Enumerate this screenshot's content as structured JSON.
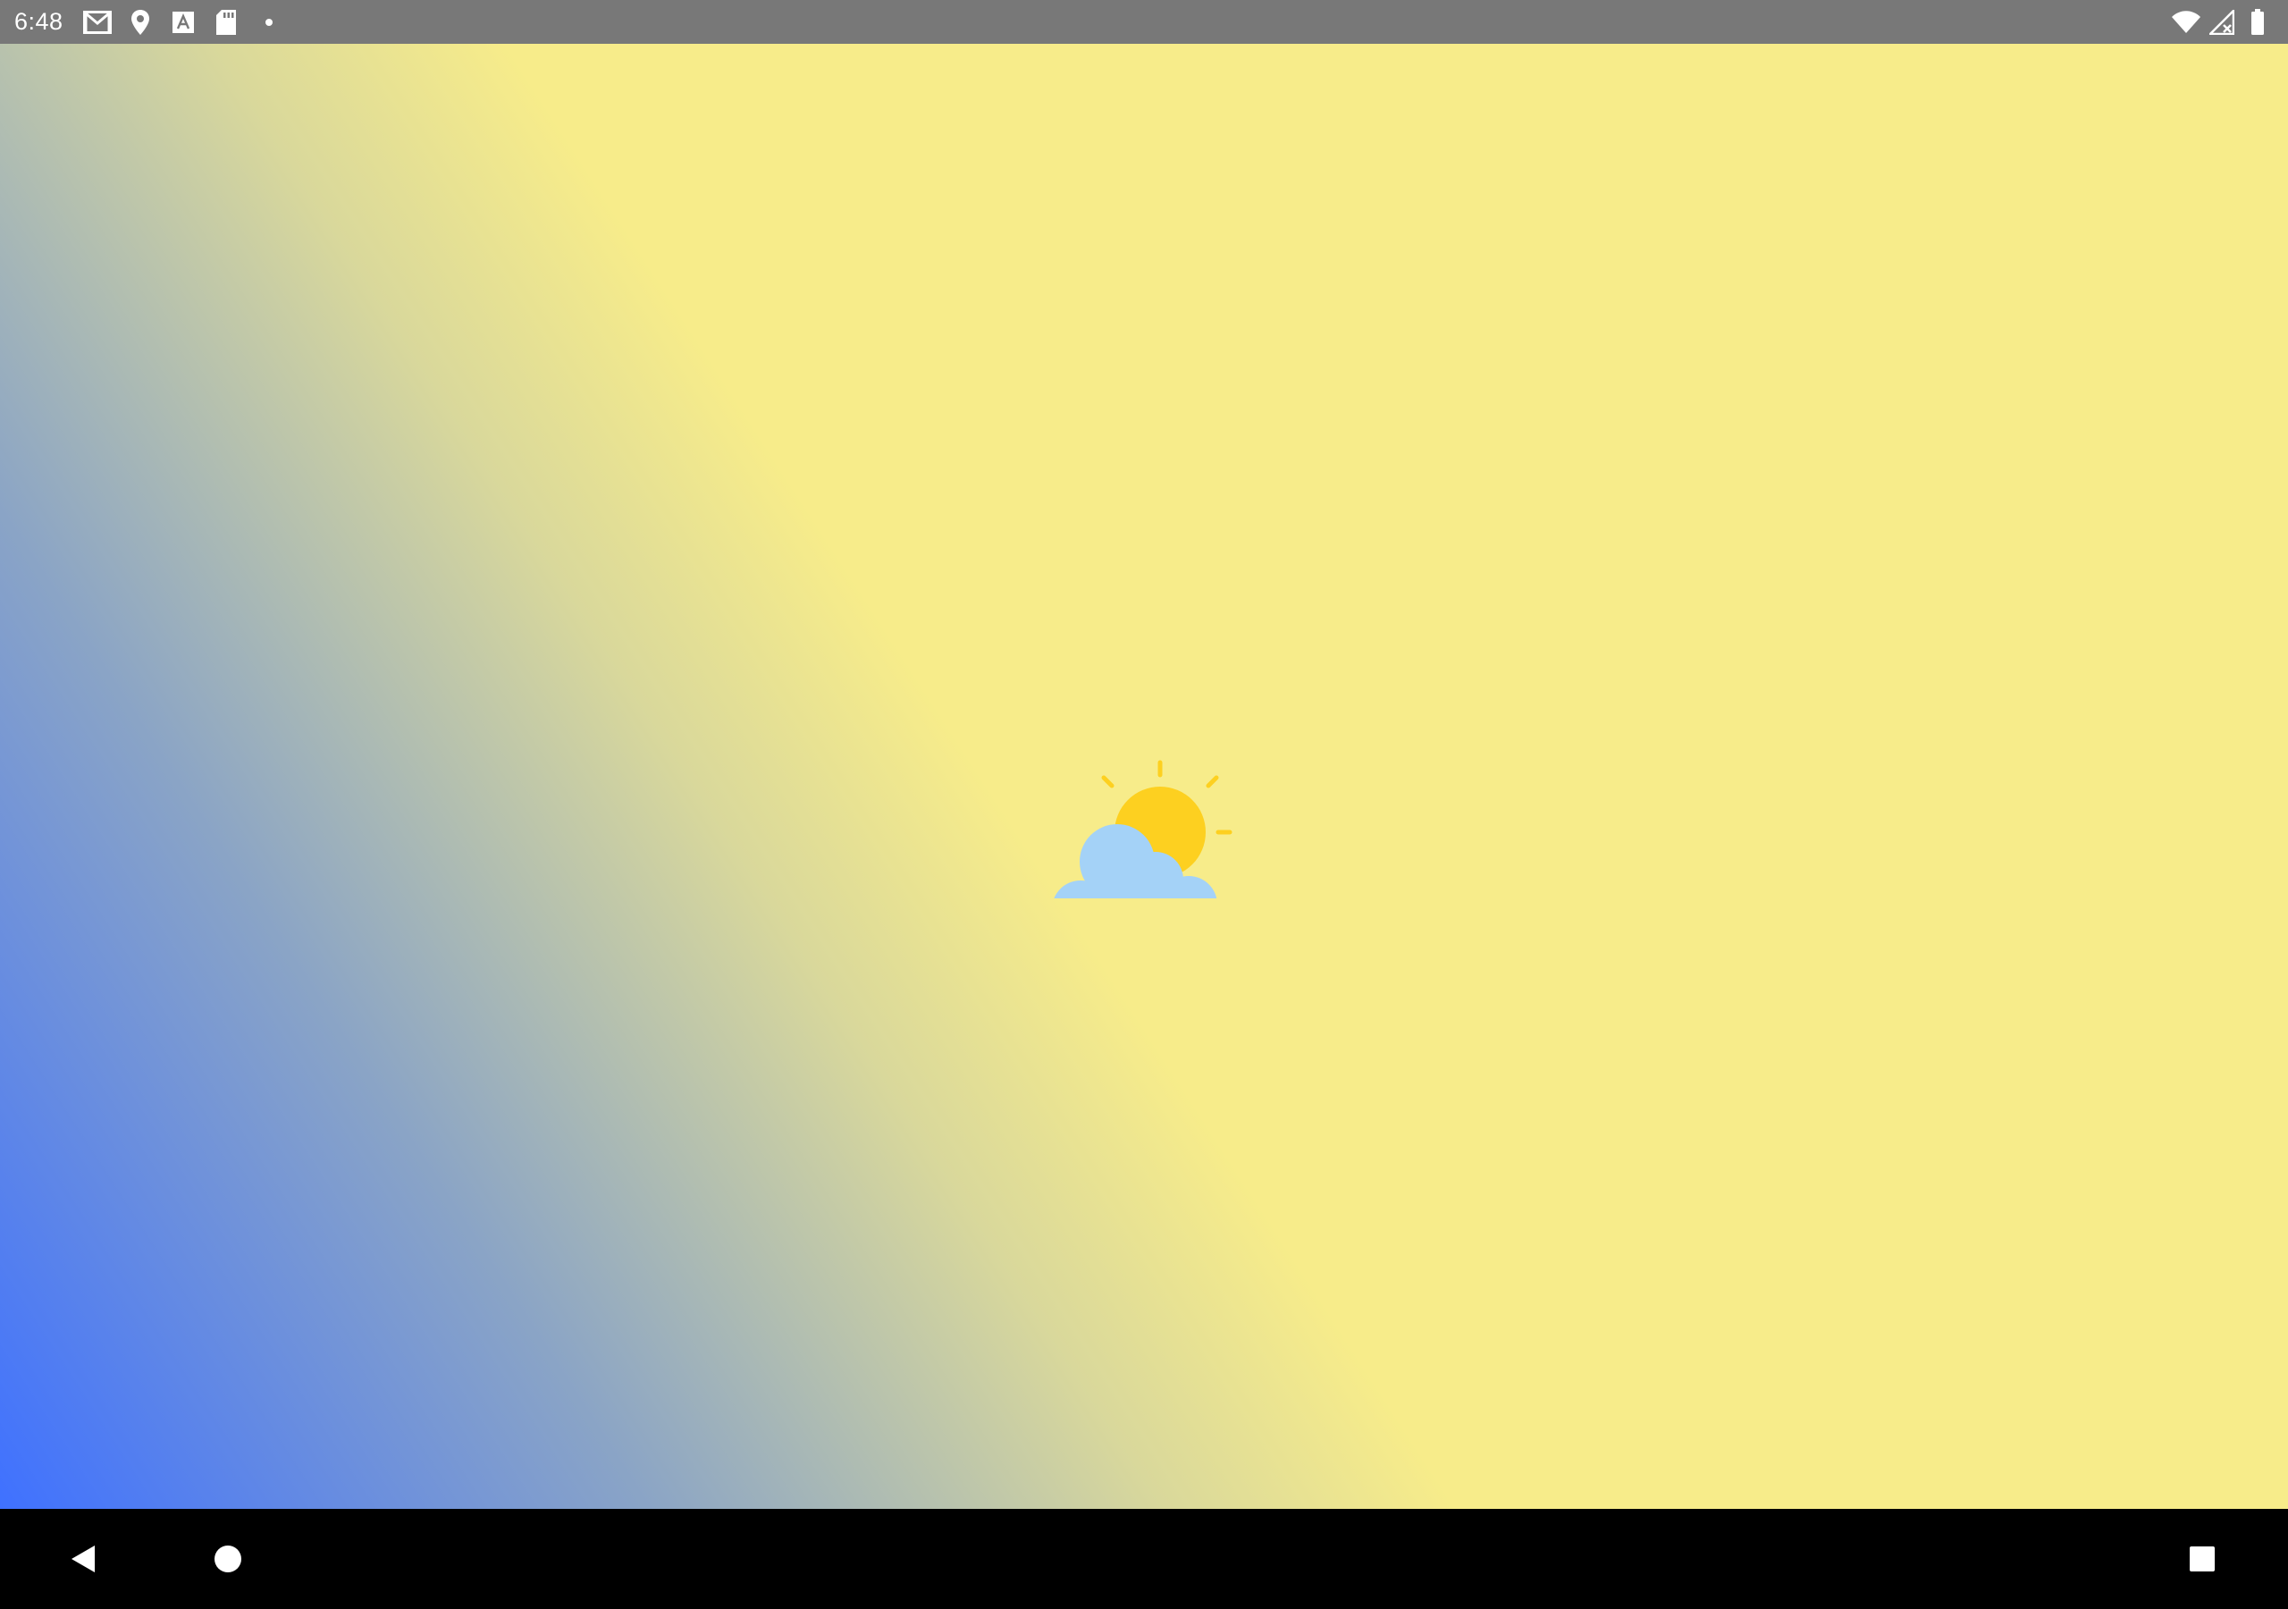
{
  "status_bar": {
    "time": "6:48",
    "left_icons": [
      "gmail-icon",
      "location-icon",
      "font-a-icon",
      "sd-card-icon",
      "notification-dot-icon"
    ],
    "right_icons": [
      "wifi-icon",
      "cellular-no-signal-icon",
      "battery-icon"
    ],
    "background_color": "#787878"
  },
  "app": {
    "background_gradient": [
      "#3f71ff",
      "#8aa4c6",
      "#d9d89b",
      "#f7ec8a"
    ],
    "center_icon": "partly-cloudy-weather-icon",
    "sun_color": "#fdd020",
    "cloud_color": "#a4d2f7"
  },
  "nav_bar": {
    "buttons": [
      "back-icon",
      "home-icon",
      "recents-icon"
    ],
    "background_color": "#000000"
  }
}
